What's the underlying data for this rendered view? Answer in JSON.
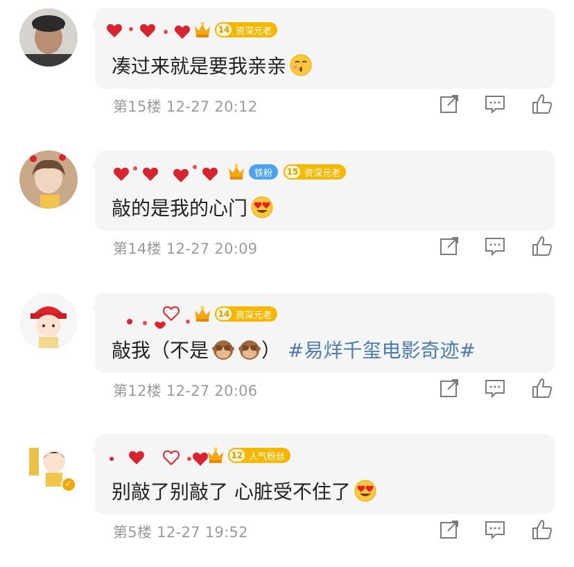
{
  "comments": [
    {
      "text": "凑过来就是要我亲亲",
      "emoji": "kiss-emoji",
      "hashtag": "",
      "badges": [
        {
          "type": "crown"
        },
        {
          "type": "fan",
          "level": "14",
          "label": "资深元老",
          "color": "#f5b800"
        }
      ],
      "floor": "第15楼",
      "time": "12-27 20:12"
    },
    {
      "text": "敲的是我的心门",
      "emoji": "heart-eyes-emoji",
      "hashtag": "",
      "badges": [
        {
          "type": "crown"
        },
        {
          "type": "fan",
          "level": "",
          "label": "铁粉",
          "color": "#4aa3f0"
        },
        {
          "type": "fan",
          "level": "15",
          "label": "资深元老",
          "color": "#f5b800"
        }
      ],
      "floor": "第14楼",
      "time": "12-27 20:09"
    },
    {
      "text": "敲我（不是",
      "text_end": "）",
      "emoji": "see-no-evil-monkey-emoji",
      "hashtag": "#易烊千玺电影奇迹#",
      "badges": [
        {
          "type": "crown"
        },
        {
          "type": "fan",
          "level": "14",
          "label": "资深元老",
          "color": "#f5b800"
        }
      ],
      "floor": "第12楼",
      "time": "12-27 20:06"
    },
    {
      "text": "别敲了别敲了 心脏受不住了",
      "emoji": "heart-eyes-emoji",
      "hashtag": "",
      "badges": [
        {
          "type": "crown"
        },
        {
          "type": "fan",
          "level": "12",
          "label": "人气粉丝",
          "color": "#f5b800"
        }
      ],
      "floor": "第5楼",
      "time": "12-27 19:52"
    }
  ],
  "icons": {
    "share": "share-icon",
    "comment": "comment-icon",
    "like": "like-icon"
  }
}
